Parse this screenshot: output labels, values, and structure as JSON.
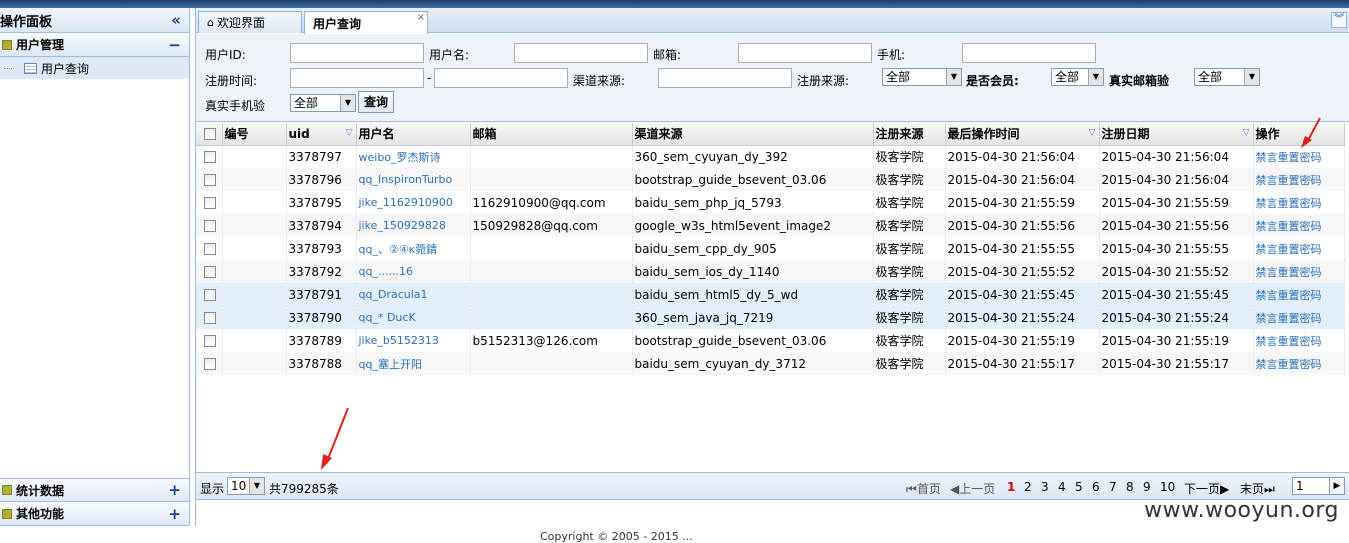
{
  "sidebar": {
    "title": "操作面板",
    "collapse_icon": "«",
    "sections": [
      {
        "label": "用户管理",
        "toggle": "−",
        "items": [
          {
            "label": "用户查询"
          }
        ]
      },
      {
        "label": "统计数据",
        "toggle": "+"
      },
      {
        "label": "其他功能",
        "toggle": "+"
      }
    ]
  },
  "tabs": [
    {
      "label": "欢迎界面",
      "icon": "home-icon"
    },
    {
      "label": "用户查询",
      "close": "×"
    }
  ],
  "search": {
    "uid_label": "用户ID:",
    "username_label": "用户名:",
    "email_label": "邮箱:",
    "phone_label": "手机:",
    "regtime_label": "注册时间:",
    "dash": "-",
    "channel_label": "渠道来源:",
    "regsource_label": "注册来源:",
    "regsource_value": "全部",
    "member_label": "是否会员:",
    "member_value": "全部",
    "realemail_label": "真实邮箱验",
    "realemail_value": "全部",
    "realphone_label": "真实手机验",
    "realphone_value": "全部",
    "query_button": "查询"
  },
  "grid": {
    "columns": [
      "编号",
      "uid",
      "用户名",
      "邮箱",
      "渠道来源",
      "注册来源",
      "最后操作时间",
      "注册日期",
      "操作"
    ],
    "rows": [
      {
        "uid": "3378797",
        "username": "weibo_罗杰斯诗",
        "email": "",
        "channel": "360_sem_cyuyan_dy_392",
        "source": "极客学院",
        "last": "2015-04-30 21:56:04",
        "reg": "2015-04-30 21:56:04",
        "ops": "禁言重置密码"
      },
      {
        "uid": "3378796",
        "username": "qq_InspironTurbo",
        "email": "",
        "channel": "bootstrap_guide_bsevent_03.06",
        "source": "极客学院",
        "last": "2015-04-30 21:56:04",
        "reg": "2015-04-30 21:56:04",
        "ops": "禁言重置密码"
      },
      {
        "uid": "3378795",
        "username": "jike_1162910900",
        "email": "1162910900@qq.com",
        "channel": "baidu_sem_php_jq_5793",
        "source": "极客学院",
        "last": "2015-04-30 21:55:59",
        "reg": "2015-04-30 21:55:59",
        "ops": "禁言重置密码"
      },
      {
        "uid": "3378794",
        "username": "jike_150929828",
        "email": "150929828@qq.com",
        "channel": "google_w3s_html5event_image2",
        "source": "极客学院",
        "last": "2015-04-30 21:55:56",
        "reg": "2015-04-30 21:55:56",
        "ops": "禁言重置密码"
      },
      {
        "uid": "3378793",
        "username": "qq_、②④κ菀錆",
        "email": "",
        "channel": "baidu_sem_cpp_dy_905",
        "source": "极客学院",
        "last": "2015-04-30 21:55:55",
        "reg": "2015-04-30 21:55:55",
        "ops": "禁言重置密码"
      },
      {
        "uid": "3378792",
        "username": "qq_......16",
        "email": "",
        "channel": "baidu_sem_ios_dy_1140",
        "source": "极客学院",
        "last": "2015-04-30 21:55:52",
        "reg": "2015-04-30 21:55:52",
        "ops": "禁言重置密码"
      },
      {
        "uid": "3378791",
        "username": "qq_Dracula1",
        "email": "",
        "channel": "baidu_sem_html5_dy_5_wd",
        "source": "极客学院",
        "last": "2015-04-30 21:55:45",
        "reg": "2015-04-30 21:55:45",
        "ops": "禁言重置密码"
      },
      {
        "uid": "3378790",
        "username": "qq_* DucK",
        "email": "",
        "channel": "360_sem_java_jq_7219",
        "source": "极客学院",
        "last": "2015-04-30 21:55:24",
        "reg": "2015-04-30 21:55:24",
        "ops": "禁言重置密码"
      },
      {
        "uid": "3378789",
        "username": "jike_b5152313",
        "email": "b5152313@126.com",
        "channel": "bootstrap_guide_bsevent_03.06",
        "source": "极客学院",
        "last": "2015-04-30 21:55:19",
        "reg": "2015-04-30 21:55:19",
        "ops": "禁言重置密码"
      },
      {
        "uid": "3378788",
        "username": "qq_塞上开阳",
        "email": "",
        "channel": "baidu_sem_cyuyan_dy_3712",
        "source": "极客学院",
        "last": "2015-04-30 21:55:17",
        "reg": "2015-04-30 21:55:17",
        "ops": "禁言重置密码"
      }
    ]
  },
  "pager": {
    "show_label": "显示",
    "page_size": "10",
    "total": "共799285条",
    "first": "首页",
    "prev": "上一页",
    "pages": [
      "1",
      "2",
      "3",
      "4",
      "5",
      "6",
      "7",
      "8",
      "9",
      "10"
    ],
    "current": "1",
    "next": "下一页",
    "last": "末页",
    "goto_value": "1"
  },
  "footer": "Copyright © 2005 - 2015 ... ",
  "watermark": "www.wooyun.org",
  "colors": {
    "accent": "#99bbe8",
    "link": "#2c6eb8",
    "current_page": "#d40000",
    "annotation_arrow": "#e02020"
  }
}
